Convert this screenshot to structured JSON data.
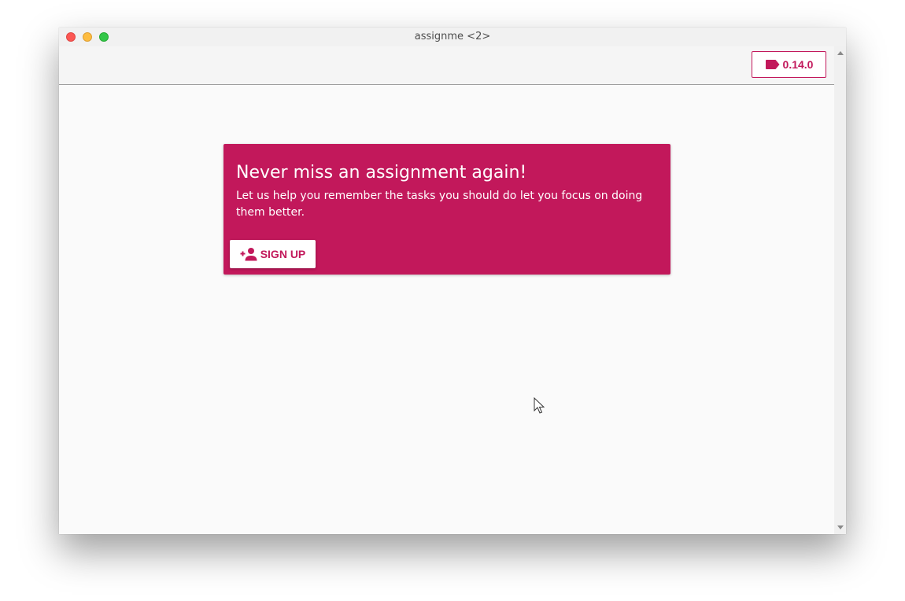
{
  "window": {
    "title": "assignme <2>"
  },
  "toolbar": {
    "version_label": "0.14.0",
    "version_icon": "label-icon"
  },
  "hero": {
    "title": "Never miss an assignment again!",
    "text": "Let us help you remember the tasks you should do let you focus on doing them better.",
    "signup_label": "SIGN UP",
    "signup_icon": "person-add-icon"
  },
  "colors": {
    "accent": "#c2185b",
    "background": "#fafafa",
    "toolbar": "#f5f5f5"
  }
}
